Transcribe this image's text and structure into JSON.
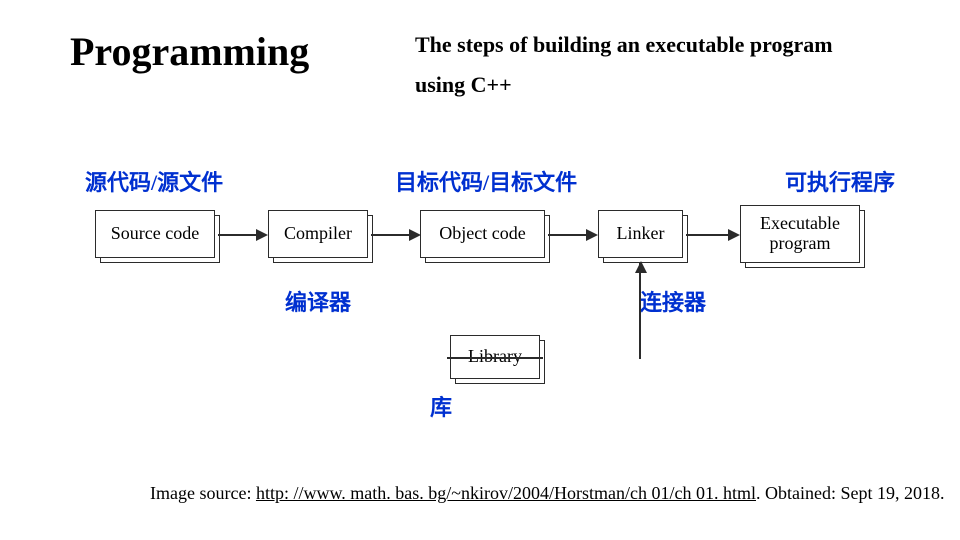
{
  "title": "Programming",
  "subtitle_line1": "The steps of building an executable program",
  "subtitle_line2": "using C++",
  "labels_zh": {
    "source": "源代码/源文件",
    "object": "目标代码/目标文件",
    "executable": "可执行程序",
    "compiler": "编译器",
    "linker": "连接器",
    "library": "库"
  },
  "boxes": {
    "source": "Source code",
    "compiler": "Compiler",
    "object": "Object code",
    "linker": "Linker",
    "executable": "Executable program",
    "library": "Library"
  },
  "citation": {
    "prefix": "Image source: ",
    "url_text": "http: //www. math. bas. bg/~nkirov/2004/Horstman/ch 01/ch 01. html",
    "suffix": ". Obtained: Sept 19, 2018."
  }
}
